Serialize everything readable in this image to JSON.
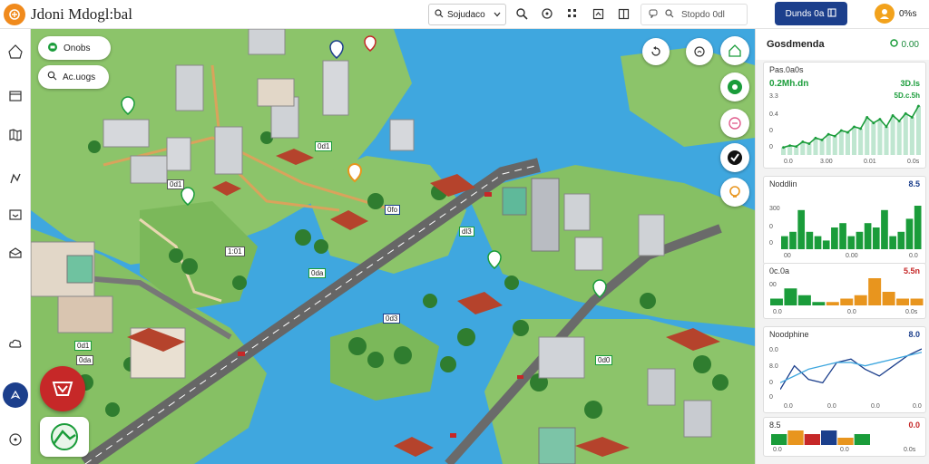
{
  "header": {
    "app_title": "Jdoni Mdogl:bal",
    "search_label": "Sojudaco",
    "search2_placeholder": "Stopdo 0dl",
    "primary_button_label": "Dunds 0a",
    "user_label": "0%s"
  },
  "map": {
    "layer_tag_1": "Onobs",
    "layer_tag_2": "Ac.uogs",
    "labels": [
      "0d1",
      "0d1",
      "0fo",
      "dl3",
      "1:01",
      "0da",
      "0d3",
      "0d1",
      "0d0",
      "0da"
    ]
  },
  "right_panel": {
    "title": "Gosdmenda",
    "status": "0.00",
    "card1": {
      "title": "Pas.0a0s",
      "headline": "0.2Mh.dn",
      "headline_value": "3D.ls",
      "value2": "5D.c.5h",
      "y_ticks": [
        "3.3",
        "0.4",
        "0",
        "0"
      ],
      "x_ticks": [
        "0.0",
        "3.00",
        "0.01",
        "0.0s"
      ],
      "chart_data": {
        "type": "area",
        "values": [
          8,
          10,
          9,
          14,
          12,
          18,
          16,
          22,
          20,
          26,
          24,
          30,
          28,
          40,
          34,
          38,
          30,
          42,
          36,
          44,
          40,
          52
        ]
      }
    },
    "card2": {
      "title": "Noddlin",
      "value": "8.5",
      "y_ticks": [
        "300",
        "0",
        "0"
      ],
      "x_ticks": [
        "00",
        "0.00",
        "0.0"
      ],
      "chart_data": {
        "type": "bar",
        "values": [
          3,
          4,
          9,
          4,
          3,
          2,
          5,
          6,
          3,
          4,
          6,
          5,
          9,
          3,
          4,
          7,
          10
        ]
      }
    },
    "card3": {
      "title": "0c.0a",
      "value": "5.5n",
      "y_ticks": [
        "00"
      ],
      "x_ticks": [
        "0.0",
        "0.0",
        "0.0s"
      ],
      "chart_data": {
        "type": "bar",
        "series": [
          {
            "color": "#1a9c3a",
            "values": [
              2,
              5,
              3,
              1
            ]
          },
          {
            "color": "#e8951e",
            "values": [
              1,
              2,
              3,
              8,
              4,
              2,
              2
            ]
          }
        ]
      }
    },
    "card4": {
      "title": "Noodphine",
      "value": "8.0",
      "y_ticks": [
        "0.0",
        "8.0",
        "0",
        "0"
      ],
      "x_ticks": [
        "0.0",
        "0.0",
        "0.0",
        "0.0"
      ],
      "chart_data": {
        "type": "line",
        "series": [
          {
            "color": "#1c3f8c",
            "values": [
              6,
              20,
              12,
              10,
              22,
              24,
              18,
              14,
              20,
              26,
              30
            ]
          },
          {
            "color": "#3fa7df",
            "values": [
              10,
              14,
              18,
              20,
              22,
              22,
              20,
              22,
              24,
              26,
              28
            ]
          }
        ]
      }
    },
    "card5": {
      "title": "8.5",
      "value": "0.0",
      "x_ticks": [
        "0.0",
        "0.0",
        "0.0s"
      ],
      "chart_data": {
        "type": "bar",
        "values": [
          3,
          4,
          3,
          4,
          2,
          3
        ]
      }
    }
  },
  "colors": {
    "accent": "#1c3f8c",
    "green": "#1a9c3a",
    "orange": "#e8951e",
    "red": "#c62828",
    "water": "#3fa7df"
  }
}
